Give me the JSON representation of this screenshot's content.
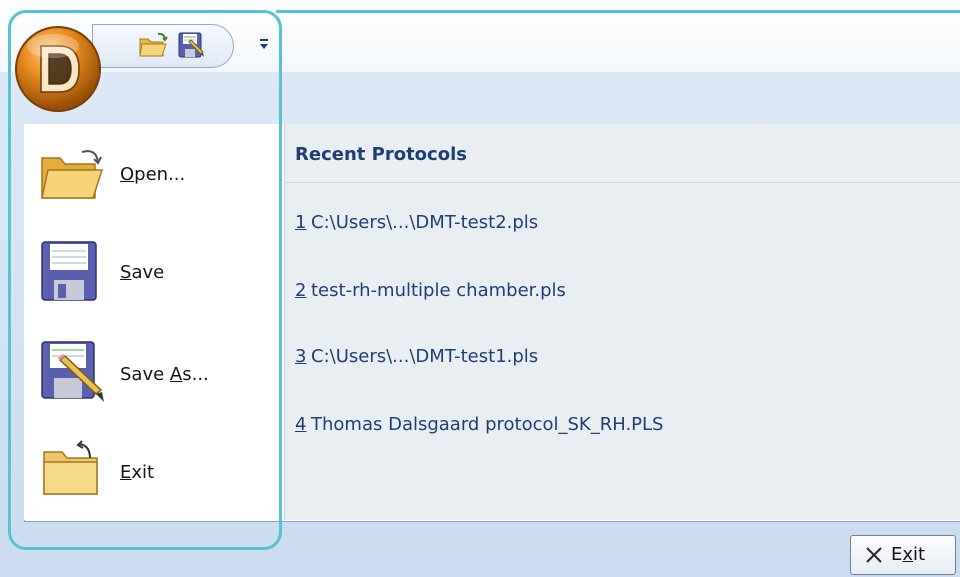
{
  "quick_access": {
    "orb_icon": "dmt-logo-orb-icon",
    "buttons": [
      {
        "icon": "open-folder-icon"
      },
      {
        "icon": "save-as-icon"
      }
    ],
    "dropdown_icon": "customize-dropdown-icon"
  },
  "recent": {
    "title": "Recent Protocols",
    "items": [
      {
        "num": "1",
        "name": "C:\\Users\\...\\DMT-test2.pls"
      },
      {
        "num": "2",
        "name": "test-rh-multiple chamber.pls"
      },
      {
        "num": "3",
        "name": "C:\\Users\\...\\DMT-test1.pls"
      },
      {
        "num": "4",
        "name": "Thomas Dalsgaard protocol_SK_RH.PLS"
      }
    ]
  },
  "menu": {
    "items": [
      {
        "id": "open",
        "access_key": "O",
        "rest": "pen...",
        "icon": "open-folder-icon"
      },
      {
        "id": "save",
        "access_key": "S",
        "rest": "ave",
        "icon": "floppy-disk-icon"
      },
      {
        "id": "save-as",
        "before": "Save ",
        "access_key": "A",
        "rest": "s...",
        "icon": "save-as-icon"
      },
      {
        "id": "exit",
        "access_key": "E",
        "rest": "xit",
        "icon": "exit-folder-icon"
      }
    ]
  },
  "footer": {
    "exit_before": "E",
    "exit_key": "x",
    "exit_rest": "it",
    "exit_icon": "close-x-icon"
  },
  "colors": {
    "accent_highlight": "#57c2d3",
    "recent_text": "#1f3f74",
    "band": "#cadcf1"
  }
}
